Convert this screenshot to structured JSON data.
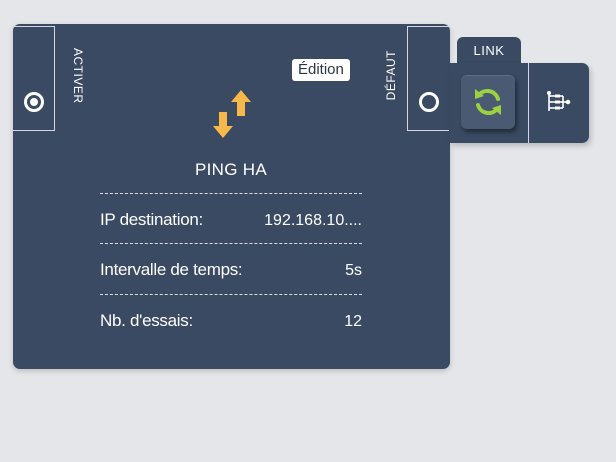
{
  "card": {
    "left_port_label": "ACTIVER",
    "right_port_label": "DÉFAUT",
    "edition_label": "Édition",
    "title": "PING HA",
    "icon": "ping-arrows-icon",
    "fields": [
      {
        "label": "IP destination:",
        "value": "192.168.10...."
      },
      {
        "label": "Intervalle de temps:",
        "value": "5s"
      },
      {
        "label": "Nb. d'essais:",
        "value": "12"
      }
    ]
  },
  "link": {
    "tab_label": "LINK",
    "sync_icon": "sync-icon",
    "tree_icon": "tree-icon"
  },
  "colors": {
    "background": "#e5e6ea",
    "card": "#3a4a62",
    "arrows": "#f6b84b",
    "sync": "#9cd13f"
  }
}
